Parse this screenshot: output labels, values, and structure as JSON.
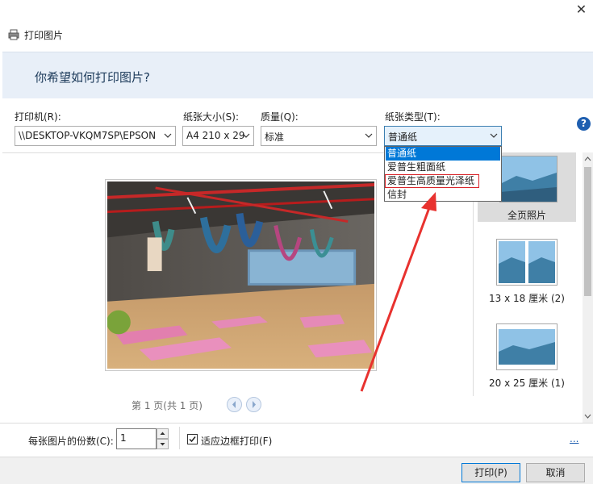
{
  "window": {
    "title": "打印图片",
    "close_glyph": "✕"
  },
  "header": {
    "question": "你希望如何打印图片?"
  },
  "printer": {
    "label": "打印机(R):",
    "value": "\\\\DESKTOP-VKQM7SP\\EPSON"
  },
  "paper_size": {
    "label": "纸张大小(S):",
    "value": "A4 210 x 29"
  },
  "quality": {
    "label": "质量(Q):",
    "value": "标准"
  },
  "paper_type": {
    "label": "纸张类型(T):",
    "value": "普通纸",
    "options": [
      "普通纸",
      "爱普生粗面纸",
      "爱普生高质量光泽纸",
      "信封"
    ],
    "selected_index": 0,
    "highlighted_index": 2
  },
  "help": {
    "glyph": "?"
  },
  "preview": {
    "page_info": "第 1 页(共 1 页)"
  },
  "layouts": [
    {
      "caption": "全页照片",
      "selected": true
    },
    {
      "caption": "13 x 18 厘米 (2)",
      "selected": false
    },
    {
      "caption": "20 x 25 厘米 (1)",
      "selected": false
    }
  ],
  "copies": {
    "label": "每张图片的份数(C):",
    "value": "1"
  },
  "fit_frame": {
    "label": "适应边框打印(F)",
    "checked": true
  },
  "more_options": {
    "label": "..."
  },
  "buttons": {
    "print": "打印(P)",
    "cancel": "取消"
  },
  "colors": {
    "accent": "#0078d7",
    "annotation_red": "#e8322f",
    "header_band": "#e8eff8"
  }
}
